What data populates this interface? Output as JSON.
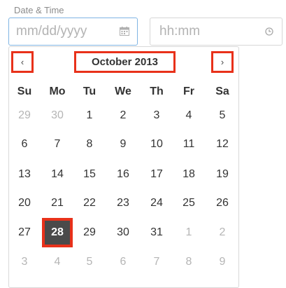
{
  "form": {
    "label": "Date & Time",
    "date_placeholder": "mm/dd/yyyy",
    "time_placeholder": "hh:mm"
  },
  "calendar": {
    "prev_label": "‹",
    "next_label": "›",
    "month_title": "October 2013",
    "weekdays": [
      "Su",
      "Mo",
      "Tu",
      "We",
      "Th",
      "Fr",
      "Sa"
    ],
    "weeks": [
      [
        {
          "d": "29",
          "muted": true
        },
        {
          "d": "30",
          "muted": true
        },
        {
          "d": "1"
        },
        {
          "d": "2"
        },
        {
          "d": "3"
        },
        {
          "d": "4"
        },
        {
          "d": "5"
        }
      ],
      [
        {
          "d": "6"
        },
        {
          "d": "7"
        },
        {
          "d": "8"
        },
        {
          "d": "9"
        },
        {
          "d": "10"
        },
        {
          "d": "11"
        },
        {
          "d": "12"
        }
      ],
      [
        {
          "d": "13"
        },
        {
          "d": "14"
        },
        {
          "d": "15"
        },
        {
          "d": "16"
        },
        {
          "d": "17"
        },
        {
          "d": "18"
        },
        {
          "d": "19"
        }
      ],
      [
        {
          "d": "20"
        },
        {
          "d": "21"
        },
        {
          "d": "22"
        },
        {
          "d": "23"
        },
        {
          "d": "24"
        },
        {
          "d": "25"
        },
        {
          "d": "26"
        }
      ],
      [
        {
          "d": "27"
        },
        {
          "d": "28",
          "selected": true
        },
        {
          "d": "29"
        },
        {
          "d": "30"
        },
        {
          "d": "31"
        },
        {
          "d": "1",
          "muted": true
        },
        {
          "d": "2",
          "muted": true
        }
      ],
      [
        {
          "d": "3",
          "muted": true
        },
        {
          "d": "4",
          "muted": true
        },
        {
          "d": "5",
          "muted": true
        },
        {
          "d": "6",
          "muted": true
        },
        {
          "d": "7",
          "muted": true
        },
        {
          "d": "8",
          "muted": true
        },
        {
          "d": "9",
          "muted": true
        }
      ]
    ]
  },
  "icons": {
    "date": "calendar-icon",
    "time": "clock-icon",
    "prev": "chevron-left-icon",
    "next": "chevron-right-icon"
  },
  "colors": {
    "highlight_border": "#e8311a",
    "selected_bg": "#4a4a4a",
    "focus_border": "#7fb4e3",
    "muted_text": "#b5b5b5"
  }
}
